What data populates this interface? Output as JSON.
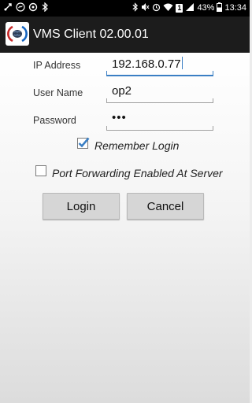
{
  "status_bar": {
    "left_icons": [
      "usb-debug-icon",
      "messenger-icon",
      "sync-icon",
      "bluetooth-icon"
    ],
    "right_icons": [
      "bluetooth-icon",
      "mute-icon",
      "alarm-icon",
      "wifi-icon",
      "sim-icon",
      "signal-icon",
      "battery-icon"
    ],
    "sim_number": "1",
    "battery": "43%",
    "time": "13:34"
  },
  "app": {
    "title": "VMS Client 02.00.01",
    "icon": "app-logo-icon"
  },
  "form": {
    "ip_label": "IP Address",
    "ip_value": "192.168.0.77",
    "user_label": "User Name",
    "user_value": "op2",
    "password_label": "Password",
    "password_value": "•••",
    "remember_label": "Remember Login",
    "remember_checked": true,
    "port_forwarding_label": "Port Forwarding Enabled At Server",
    "port_forwarding_checked": false
  },
  "buttons": {
    "login_label": "Login",
    "cancel_label": "Cancel"
  },
  "colors": {
    "accent": "#3b7fc4",
    "appbar": "#1c1c1c",
    "button": "#d6d6d6"
  }
}
